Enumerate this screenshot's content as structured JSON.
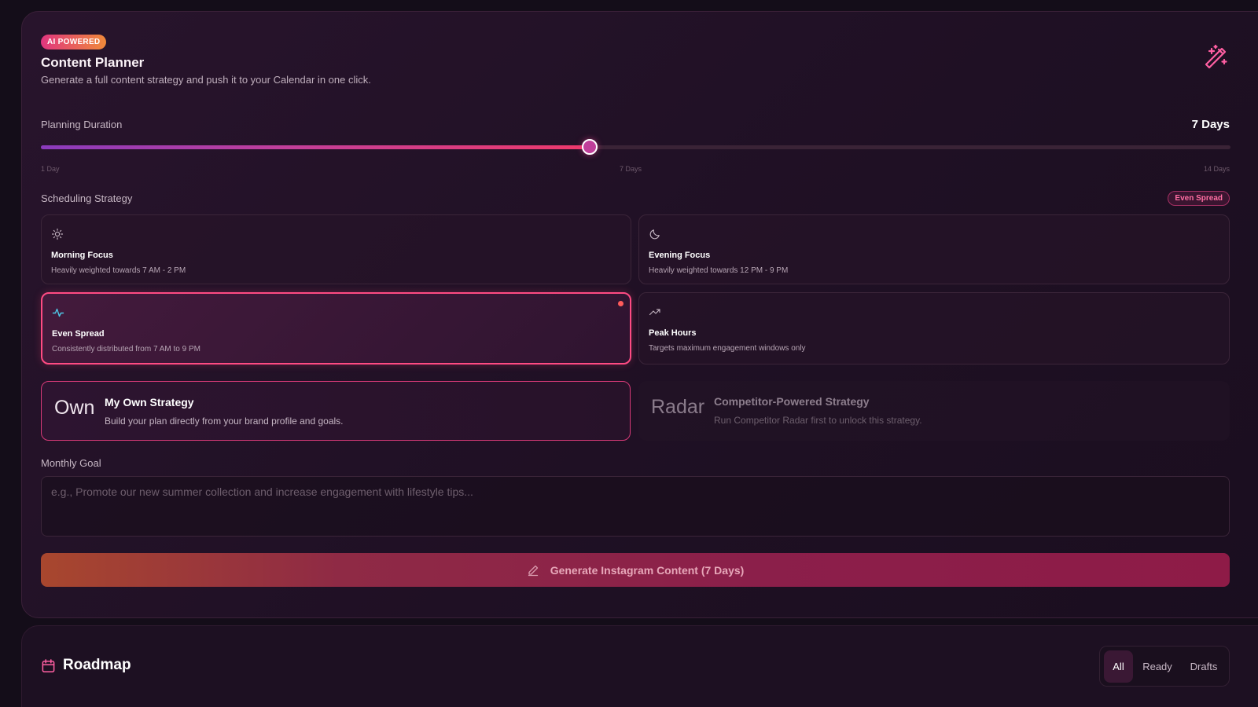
{
  "header": {
    "badge": "AI POWERED",
    "title": "Content Planner",
    "subtitle": "Generate a full content strategy and push it to your Calendar in one click.",
    "icon": "magic-wand-icon"
  },
  "duration": {
    "label": "Planning Duration",
    "value_text": "7 Days",
    "value": 7,
    "min": 1,
    "max": 14,
    "ticks": [
      "1 Day",
      "7 Days",
      "14 Days"
    ]
  },
  "scheduling": {
    "label": "Scheduling Strategy",
    "selected_badge": "Even Spread",
    "options": [
      {
        "icon": "sun-icon",
        "title": "Morning Focus",
        "desc": "Heavily weighted towards 7 AM - 2 PM",
        "selected": false
      },
      {
        "icon": "moon-icon",
        "title": "Evening Focus",
        "desc": "Heavily weighted towards 12 PM - 9 PM",
        "selected": false
      },
      {
        "icon": "pulse-icon",
        "title": "Even Spread",
        "desc": "Consistently distributed from 7 AM to 9 PM",
        "selected": true
      },
      {
        "icon": "trending-up-icon",
        "title": "Peak Hours",
        "desc": "Targets maximum engagement windows only",
        "selected": false
      }
    ]
  },
  "strategies": [
    {
      "tag": "Own",
      "title": "My Own Strategy",
      "desc": "Build your plan directly from your brand profile and goals.",
      "selected": true
    },
    {
      "tag": "Radar",
      "title": "Competitor-Powered Strategy",
      "desc": "Run Competitor Radar first to unlock this strategy.",
      "disabled": true
    }
  ],
  "goal": {
    "label": "Monthly Goal",
    "placeholder": "e.g., Promote our new summer collection and increase engagement with lifestyle tips...",
    "value": ""
  },
  "generate_button": {
    "icon": "pencil-icon",
    "label": "Generate Instagram Content (7 Days)"
  },
  "roadmap": {
    "icon": "calendar-icon",
    "title": "Roadmap",
    "filters": [
      "All",
      "Ready",
      "Drafts"
    ],
    "active_filter": "All"
  },
  "colors": {
    "accent": "#ff4b83",
    "background": "#140d19",
    "panel": "#221226"
  }
}
